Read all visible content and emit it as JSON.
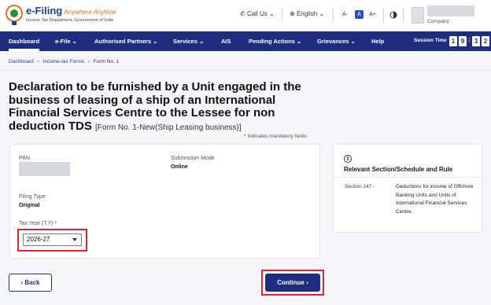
{
  "header": {
    "logo_title": "e-Filing",
    "logo_tagline": "Anywhere Anytime",
    "logo_sub_line1": "Income Tax Department, Government of India",
    "call_us": "Call Us",
    "language": "English",
    "font_decrease": "A-",
    "font_default": "A",
    "font_increase": "A+",
    "company_label": "Company"
  },
  "nav": {
    "items": [
      {
        "label": "Dashboard"
      },
      {
        "label": "e-File ⌄"
      },
      {
        "label": "Authorised Partners ⌄"
      },
      {
        "label": "Services ⌄"
      },
      {
        "label": "AIS"
      },
      {
        "label": "Pending Actions ⌄"
      },
      {
        "label": "Grievances ⌄"
      },
      {
        "label": "Help"
      }
    ],
    "session_label": "Session Time",
    "session_digits": [
      "1",
      "9",
      "3",
      "2"
    ],
    "session_colon": ":"
  },
  "breadcrumb": {
    "items": [
      "Dashboard",
      "Income-tax Forms",
      "Form No. 1"
    ],
    "separator": "›"
  },
  "page": {
    "title": "Declaration to be furnished by a Unit engaged in the business of leasing of a ship of an International Financial Services Centre to the Lessee for non deduction TDS",
    "form_ref": "[Form No. 1-New(Ship Leasing business)]",
    "mandatory_star": "*",
    "mandatory_note": "Indicates mandatory fields"
  },
  "form": {
    "pan_label": "PAN",
    "submission_mode_label": "Submission Mode",
    "submission_mode_value": "Online",
    "filing_type_label": "Filing Type",
    "filing_type_value": "Original",
    "tax_year_label": "Tax Year (T.Y)",
    "tax_year_star": "*",
    "tax_year_value": "2026-27"
  },
  "side": {
    "heading": "Relevant Section/Schedule and Rule",
    "section_link": "Section 147 -",
    "section_desc": "Deductions for income of Offshore Banking Units and Units of International Financial Services Centre."
  },
  "actions": {
    "back_label": "‹  Back",
    "continue_label": "Continue  ›"
  },
  "colors": {
    "nav_bg": "#1e2d7d",
    "highlight": "#d8262a",
    "link": "#1d3f8f"
  }
}
